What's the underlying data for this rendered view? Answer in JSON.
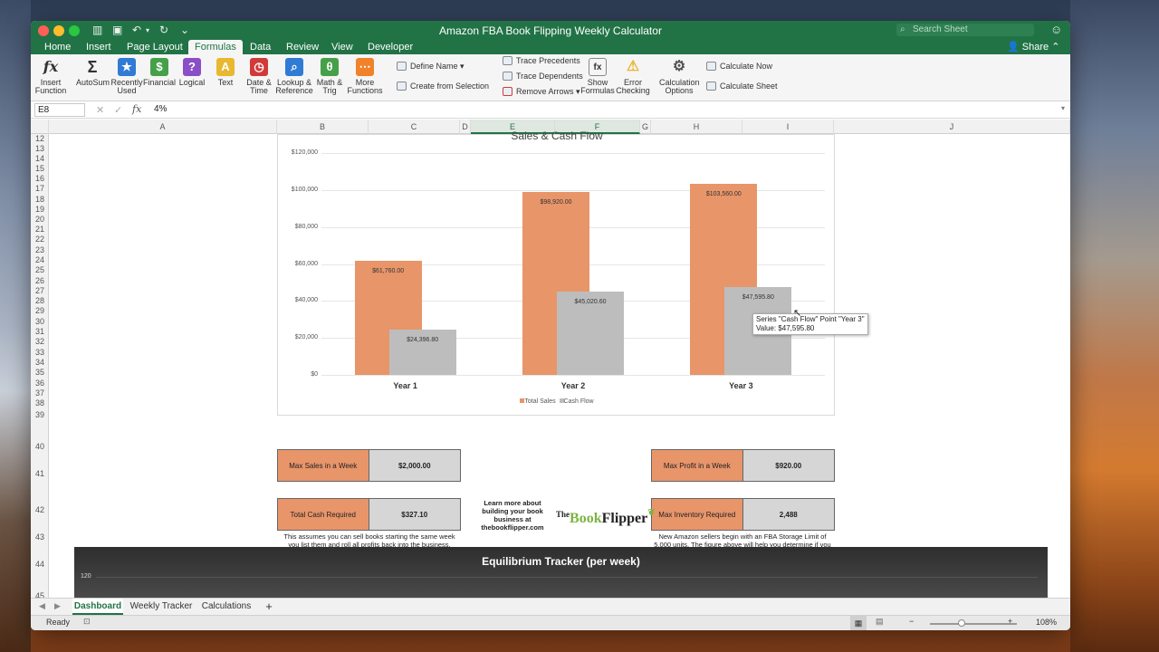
{
  "window": {
    "title": "Amazon FBA Book Flipping Weekly Calculator",
    "search_placeholder": "Search Sheet",
    "share": "Share"
  },
  "menu": {
    "tabs": [
      "Home",
      "Insert",
      "Page Layout",
      "Formulas",
      "Data",
      "Review",
      "View",
      "Developer"
    ],
    "active": "Formulas"
  },
  "ribbon": {
    "insert_function": "Insert Function",
    "autosum": "AutoSum",
    "recently_used": "Recently Used",
    "financial": "Financial",
    "logical": "Logical",
    "text": "Text",
    "date_time": "Date & Time",
    "lookup": "Lookup & Reference",
    "math": "Math & Trig",
    "more": "More Functions",
    "define_name": "Define Name",
    "create_from_selection": "Create from Selection",
    "trace_precedents": "Trace Precedents",
    "trace_dependents": "Trace Dependents",
    "remove_arrows": "Remove Arrows",
    "show_formulas": "Show Formulas",
    "error_checking": "Error Checking",
    "calc_options": "Calculation Options",
    "calc_now": "Calculate Now",
    "calc_sheet": "Calculate Sheet"
  },
  "formula_bar": {
    "cell_ref": "E8",
    "value": "4%"
  },
  "columns": [
    "A",
    "B",
    "C",
    "D",
    "E",
    "F",
    "G",
    "H",
    "I",
    "J"
  ],
  "rows": [
    "12",
    "13",
    "14",
    "15",
    "16",
    "17",
    "18",
    "19",
    "20",
    "21",
    "22",
    "23",
    "24",
    "25",
    "26",
    "27",
    "28",
    "29",
    "30",
    "31",
    "32",
    "33",
    "34",
    "35",
    "36",
    "37",
    "38",
    "39",
    "40",
    "41",
    "42",
    "43",
    "44",
    "45"
  ],
  "chart_data": {
    "type": "bar",
    "title": "Sales & Cash Flow",
    "categories": [
      "Year 1",
      "Year 2",
      "Year 3"
    ],
    "series": [
      {
        "name": "Total Sales",
        "values": [
          61760,
          98920,
          103560
        ],
        "labels": [
          "$61,760.00",
          "$98,920.00",
          "$103,560.00"
        ],
        "color": "#e8956a"
      },
      {
        "name": "Cash Flow",
        "values": [
          24396.8,
          45020.6,
          47595.8
        ],
        "labels": [
          "$24,396.80",
          "$45,020.60",
          "$47,595.80"
        ],
        "color": "#bdbdbd"
      }
    ],
    "ylim": [
      0,
      120000
    ],
    "yticks": [
      "$0",
      "$20,000",
      "$40,000",
      "$60,000",
      "$80,000",
      "$100,000",
      "$120,000"
    ],
    "legend": "bottom",
    "grid": true
  },
  "tooltip": {
    "line1": "Series \"Cash Flow\" Point \"Year 3\"",
    "line2": "Value:  $47,595.80"
  },
  "kpis": {
    "max_sales": {
      "label": "Max Sales in a Week",
      "value": "$2,000.00"
    },
    "max_profit": {
      "label": "Max Profit in a Week",
      "value": "$920.00"
    },
    "total_cash": {
      "label": "Total Cash Required",
      "value": "$327.10"
    },
    "max_inventory": {
      "label": "Max Inventory Required",
      "value": "2,488"
    }
  },
  "notes": {
    "cash_note": "This assumes you can sell books starting the same week you list them and roll all profits back into the business.  Add a bit to this amount as a buffer.",
    "learn_more": "Learn more about building your book business at thebookflipper.com",
    "inventory_note": "New Amazon sellers begin with an FBA Storage Limit of 5,000 units.  The figure above will help you determine if you need to get your limits raised."
  },
  "logo": {
    "text1": "The",
    "text2": "Book",
    "text3": "Flipper"
  },
  "equilibrium": {
    "title": "Equilibrium Tracker (per week)",
    "first_tick": "120"
  },
  "sheets": {
    "tabs": [
      "Dashboard",
      "Weekly Tracker",
      "Calculations"
    ],
    "active": "Dashboard",
    "add": "+"
  },
  "status": {
    "ready": "Ready",
    "zoom": "108%",
    "minus": "−",
    "plus": "+"
  }
}
